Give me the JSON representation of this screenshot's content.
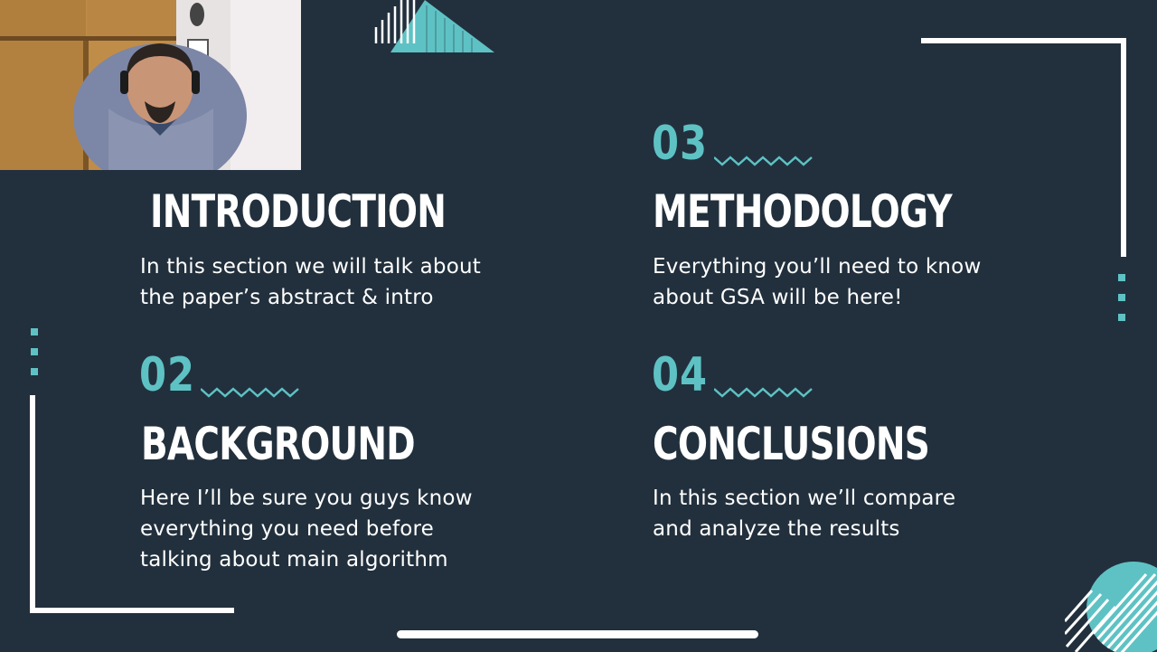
{
  "sections": [
    {
      "title": "INTRODUCTION",
      "description_lines": [
        "In this section we will talk about",
        "the paper’s abstract & intro"
      ]
    },
    {
      "number": "02",
      "title": "BACKGROUND",
      "description_lines": [
        "Here I’ll be sure you guys know",
        "everything you need before",
        "talking about main algorithm"
      ]
    },
    {
      "number": "03",
      "title": "METHODOLOGY",
      "description_lines": [
        "Everything you’ll need to know",
        "about GSA will be here!"
      ]
    },
    {
      "number": "04",
      "title": "CONCLUSIONS",
      "description_lines": [
        "In this section we’ll compare",
        "and analyze the results"
      ]
    }
  ],
  "colors": {
    "background": "#22303d",
    "accent": "#5ec2c4",
    "text": "#ffffff"
  }
}
